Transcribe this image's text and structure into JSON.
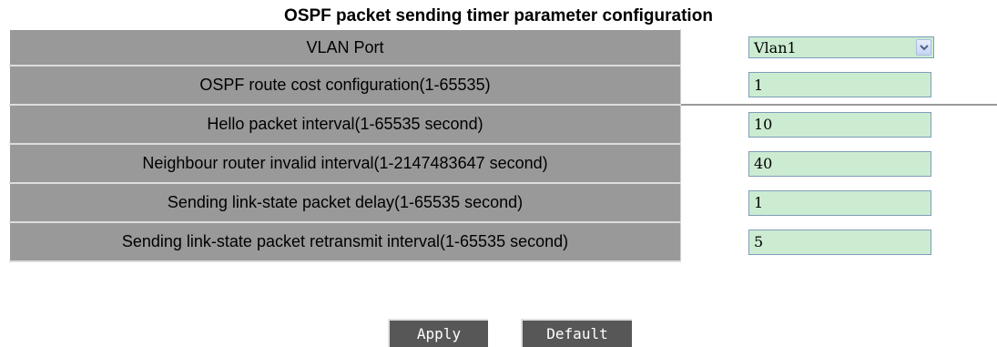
{
  "page": {
    "title": "OSPF packet sending timer parameter configuration"
  },
  "form": {
    "rows": [
      {
        "label": "VLAN Port",
        "type": "select",
        "value": "Vlan1"
      },
      {
        "label": "OSPF route cost configuration(1-65535)",
        "type": "text",
        "value": "1"
      },
      {
        "label": "Hello packet interval(1-65535 second)",
        "type": "text",
        "value": "10"
      },
      {
        "label": "Neighbour router invalid interval(1-2147483647 second)",
        "type": "text",
        "value": "40"
      },
      {
        "label": "Sending link-state packet delay(1-65535 second)",
        "type": "text",
        "value": "1"
      },
      {
        "label": "Sending link-state packet retransmit interval(1-65535 second)",
        "type": "text",
        "value": "5"
      }
    ]
  },
  "buttons": {
    "apply": "Apply",
    "default": "Default"
  },
  "colors": {
    "label_background": "#999999",
    "input_background": "#ccecd2",
    "button_background": "#575757"
  },
  "icons": {
    "select_arrow": "chevron-down-icon"
  }
}
